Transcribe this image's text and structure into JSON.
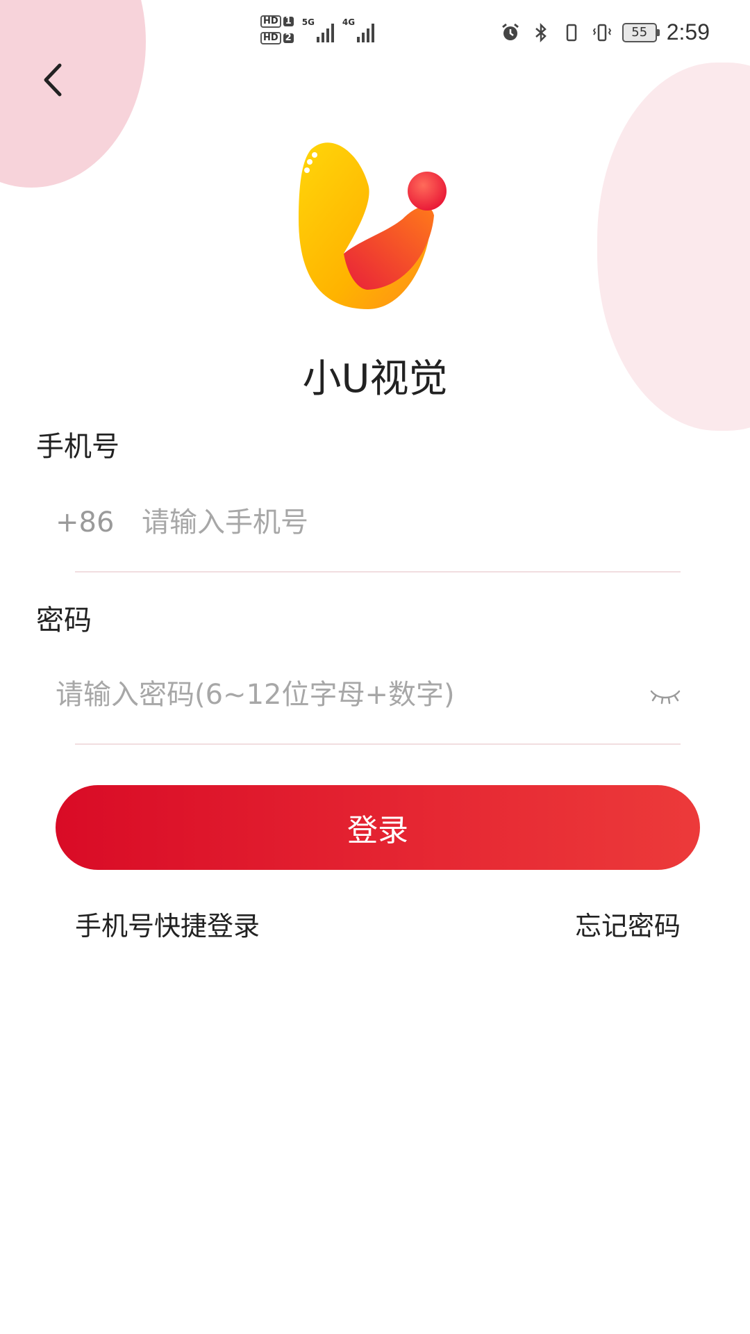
{
  "status_bar": {
    "sim1": "HD",
    "sim1_num": "1",
    "sim2": "HD",
    "sim2_num": "2",
    "net1": "5G",
    "net2": "4G",
    "battery": "55",
    "time": "2:59",
    "icons": [
      "alarm-icon",
      "bluetooth-icon",
      "phone-icon",
      "vibrate-icon"
    ]
  },
  "app": {
    "name": "小U视觉"
  },
  "phone": {
    "label": "手机号",
    "country_code": "+86",
    "placeholder": "请输入手机号"
  },
  "password": {
    "label": "密码",
    "placeholder": "请输入密码(6~12位字母+数字)"
  },
  "buttons": {
    "login": "登录"
  },
  "links": {
    "quick_login": "手机号快捷登录",
    "forgot_password": "忘记密码"
  },
  "colors": {
    "accent": "#e01e2c",
    "logo_yellow": "#ffc107",
    "logo_red": "#e8203a"
  }
}
